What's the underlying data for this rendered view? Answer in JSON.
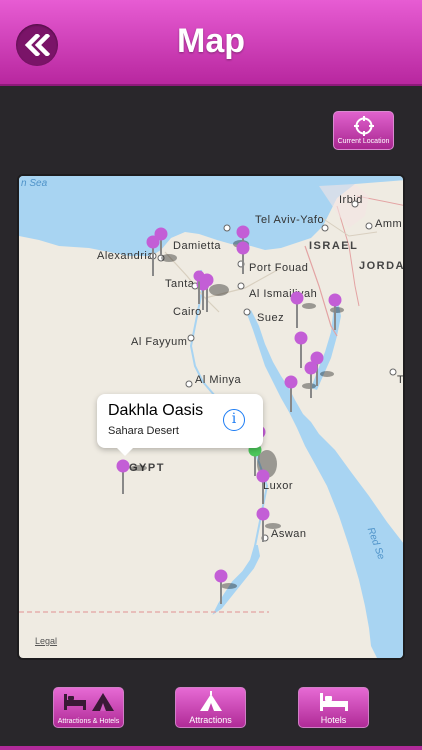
{
  "header": {
    "title": "Map",
    "back_icon": "double-chevron-left-icon"
  },
  "current_location": {
    "label": "Current Location",
    "icon": "crosshair-icon"
  },
  "map": {
    "seas": {
      "mediterranean": "n Sea",
      "red_sea": "Red Se"
    },
    "cities": {
      "irbid": "Irbid",
      "tel_aviv": "Tel Aviv-Yafo",
      "amman": "Amm",
      "alexandria": "Alexandria",
      "damietta": "Damietta",
      "israel": "ISRAEL",
      "jordan": "JORDA",
      "tanta": "Tanta",
      "port_fouad": "Port Fouad",
      "al_ismailiyah": "Al Ismailiyah",
      "cairo": "Cairo",
      "suez": "Suez",
      "al_fayyum": "Al Fayyum",
      "al_minya": "Al Minya",
      "egypt": "GYPT",
      "luxor": "Luxor",
      "aswan": "Aswan",
      "t": "T"
    },
    "legal": "Legal",
    "callout": {
      "title": "Dakhla Oasis",
      "subtitle": "Sahara Desert",
      "info_icon": "info-icon"
    },
    "pin_colors": {
      "default": "#c35ed6",
      "selected": "#4cc85b"
    }
  },
  "tabs": [
    {
      "label": "Attractions & Hotels",
      "icon": "bed-and-tent-icon"
    },
    {
      "label": "Attractions",
      "icon": "tent-icon"
    },
    {
      "label": "Hotels",
      "icon": "bed-icon"
    }
  ],
  "colors": {
    "header": "#d448bd",
    "background": "#29272b",
    "water": "#a8d4f2",
    "land": "#efebe2"
  }
}
